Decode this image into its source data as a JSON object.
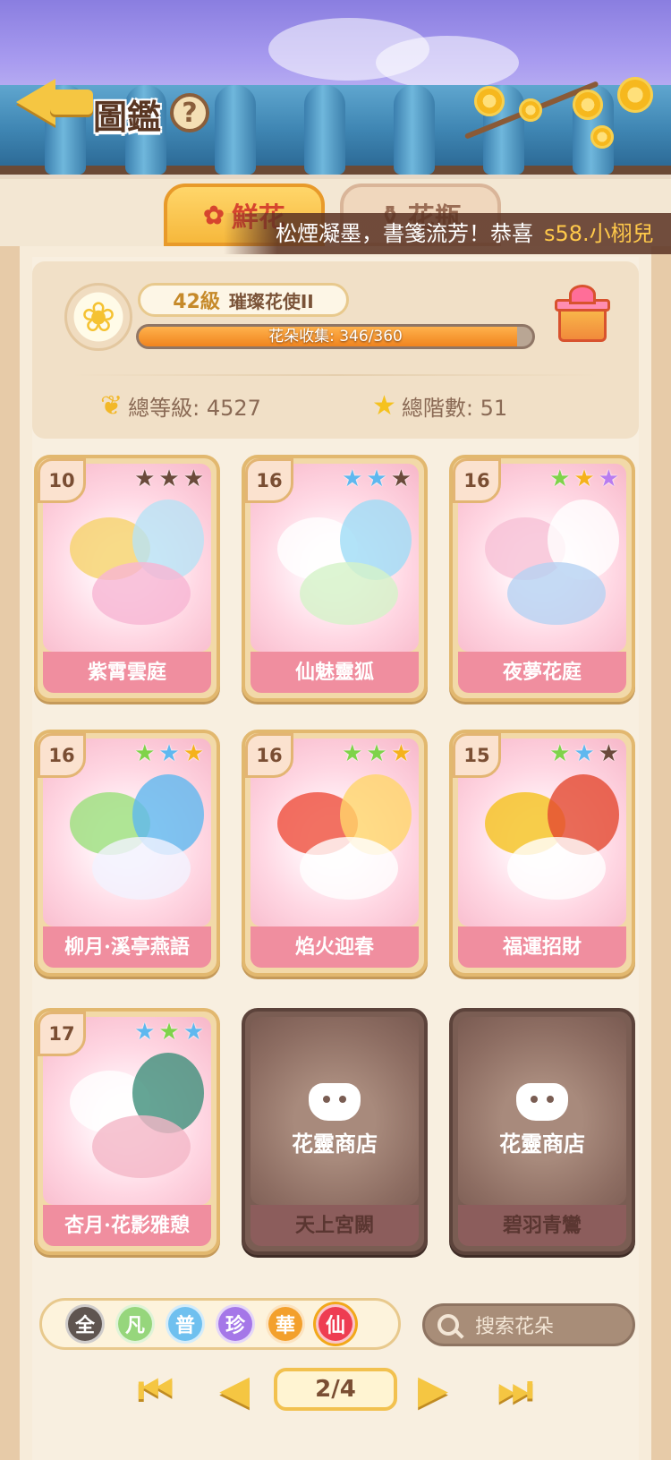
{
  "header": {
    "title": "圖鑑",
    "help_label": "?"
  },
  "tabs": [
    {
      "label": "鮮花",
      "icon": "rose-icon",
      "active": true
    },
    {
      "label": "花瓶",
      "icon": "vase-icon",
      "active": false
    }
  ],
  "ticker": {
    "message": "松煙凝墨，書箋流芳！恭喜",
    "player": "s58.小栩兒"
  },
  "profile": {
    "level": "42級",
    "rank_title": "璀璨花使II",
    "collection_text": "花朵收集: 346/360",
    "collection_progress": 0.961,
    "total_level": "總等級: 4527",
    "total_stage": "總階數: 51"
  },
  "cards": [
    {
      "level": "10",
      "name": "紫霄雲庭",
      "stars": [
        "brown",
        "brown",
        "brown"
      ],
      "locked": false,
      "palette": [
        "#f6d36b",
        "#b8e2f5",
        "#f7b5d3"
      ]
    },
    {
      "level": "16",
      "name": "仙魅靈狐",
      "stars": [
        "blue",
        "blue",
        "brown"
      ],
      "locked": false,
      "palette": [
        "#ffffff",
        "#9fdcf6",
        "#d4f2c8"
      ]
    },
    {
      "level": "16",
      "name": "夜夢花庭",
      "stars": [
        "green",
        "gold",
        "purple"
      ],
      "locked": false,
      "palette": [
        "#f7c1d6",
        "#ffffff",
        "#b7d2f2"
      ]
    },
    {
      "level": "16",
      "name": "柳月·溪亭燕語",
      "stars": [
        "green",
        "blue",
        "gold"
      ],
      "locked": false,
      "palette": [
        "#9be07c",
        "#5fb8ef",
        "#f2f2ff"
      ]
    },
    {
      "level": "16",
      "name": "焰火迎春",
      "stars": [
        "green",
        "green",
        "gold"
      ],
      "locked": false,
      "palette": [
        "#ef4f3c",
        "#ffd66a",
        "#ffffff"
      ]
    },
    {
      "level": "15",
      "name": "福運招財",
      "stars": [
        "green",
        "blue",
        "brown"
      ],
      "locked": false,
      "palette": [
        "#f5c21e",
        "#e4492f",
        "#ffffff"
      ]
    },
    {
      "level": "17",
      "name": "杏月·花影雅憩",
      "stars": [
        "blue",
        "green",
        "blue"
      ],
      "locked": false,
      "palette": [
        "#ffffff",
        "#3f8f7a",
        "#f4b7c7"
      ]
    },
    {
      "level": "",
      "name": "天上宮闕",
      "stars": [],
      "locked": true,
      "shop_label": "花靈商店"
    },
    {
      "level": "",
      "name": "碧羽青鸞",
      "stars": [],
      "locked": true,
      "shop_label": "花靈商店"
    }
  ],
  "filters": [
    {
      "label": "全",
      "color": "#5f5550"
    },
    {
      "label": "凡",
      "color": "#96d67c"
    },
    {
      "label": "普",
      "color": "#6fc0ef"
    },
    {
      "label": "珍",
      "color": "#a577e8"
    },
    {
      "label": "華",
      "color": "#f3a02c"
    },
    {
      "label": "仙",
      "color": "#ee3d52",
      "active": true
    }
  ],
  "search": {
    "placeholder": "搜索花朵"
  },
  "pagination": {
    "current": "2/4"
  }
}
